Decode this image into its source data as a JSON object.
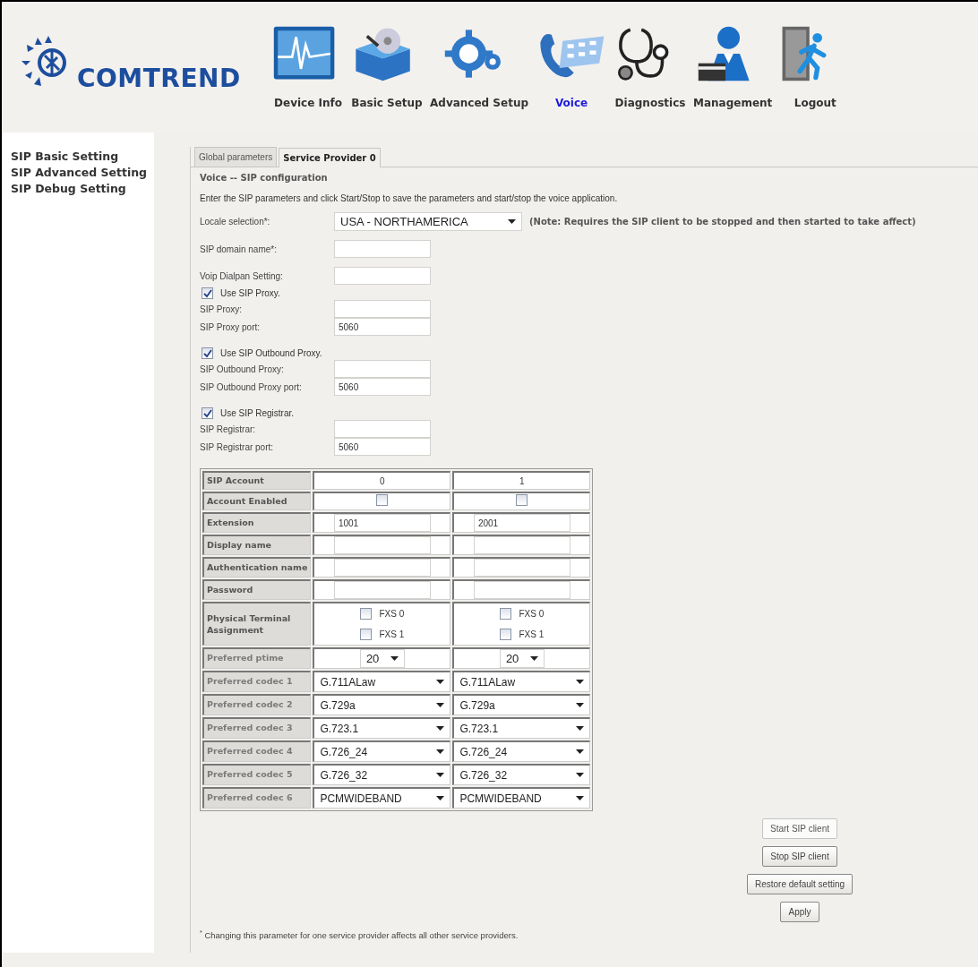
{
  "header": {
    "logo_text": "COMTREND",
    "nav": [
      {
        "label": "Device Info",
        "selected": false
      },
      {
        "label": "Basic Setup",
        "selected": false
      },
      {
        "label": "Advanced Setup",
        "selected": false
      },
      {
        "label": "Voice",
        "selected": true
      },
      {
        "label": "Diagnostics",
        "selected": false
      },
      {
        "label": "Management",
        "selected": false
      },
      {
        "label": "Logout",
        "selected": false
      }
    ]
  },
  "sidebar": {
    "items": [
      {
        "label": "SIP Basic Setting"
      },
      {
        "label": "SIP Advanced Setting"
      },
      {
        "label": "SIP Debug Setting"
      }
    ]
  },
  "tabs": [
    {
      "label": "Global parameters",
      "selected": false
    },
    {
      "label": "Service Provider 0",
      "selected": true
    }
  ],
  "section_title": "Voice -- SIP configuration",
  "intro": "Enter the SIP parameters and click Start/Stop to save the parameters and start/stop the voice application.",
  "locale": {
    "label": "Locale selection*:",
    "value": "USA - NORTHAMERICA",
    "note": "(Note: Requires the SIP client to be stopped and then started to take affect)"
  },
  "field_groups": [
    [
      {
        "kind": "input",
        "label": "SIP domain name*:"
      }
    ],
    [
      {
        "kind": "input",
        "label": "Voip Dialpan Setting:"
      },
      {
        "kind": "check",
        "label": "Use SIP Proxy.",
        "checked": true
      },
      {
        "kind": "input",
        "label": "SIP Proxy:"
      },
      {
        "kind": "input",
        "label": "SIP Proxy port:",
        "value": "5060"
      }
    ],
    [
      {
        "kind": "check",
        "label": "Use SIP Outbound Proxy.",
        "checked": true
      },
      {
        "kind": "input",
        "label": "SIP Outbound Proxy:"
      },
      {
        "kind": "input",
        "label": "SIP Outbound Proxy port:",
        "value": "5060"
      }
    ],
    [
      {
        "kind": "check",
        "label": "Use SIP Registrar.",
        "checked": true
      },
      {
        "kind": "input",
        "label": "SIP Registrar:"
      },
      {
        "kind": "input",
        "label": "SIP Registrar port:",
        "value": "5060"
      }
    ]
  ],
  "accounts": [
    {
      "kind": "header",
      "label": "SIP Account",
      "cells": [
        {
          "value": "0"
        },
        {
          "value": "1"
        }
      ]
    },
    {
      "kind": "checkbox",
      "label": "Account Enabled",
      "cells": [
        {
          "checked": false
        },
        {
          "checked": false
        }
      ]
    },
    {
      "kind": "input",
      "label": "Extension",
      "cells": [
        {
          "value": "1001"
        },
        {
          "value": "2001"
        }
      ]
    },
    {
      "kind": "input",
      "label": "Display name",
      "cells": [
        {},
        {}
      ]
    },
    {
      "kind": "input",
      "label": "Authentication name",
      "cells": [
        {},
        {}
      ]
    },
    {
      "kind": "input",
      "label": "Password",
      "cells": [
        {},
        {}
      ]
    },
    {
      "kind": "terminal",
      "label": "Physical Terminal Assignment",
      "cells": [
        {
          "options": [
            {
              "label": "FXS 0",
              "checked": false
            },
            {
              "label": "FXS 1",
              "checked": false
            }
          ]
        },
        {
          "options": [
            {
              "label": "FXS 0",
              "checked": false
            },
            {
              "label": "FXS 1",
              "checked": false
            }
          ]
        }
      ]
    },
    {
      "kind": "ptime",
      "label": "Preferred ptime",
      "cells": [
        {
          "value": "20"
        },
        {
          "value": "20"
        }
      ]
    },
    {
      "kind": "select",
      "label": "Preferred codec 1",
      "cells": [
        {
          "value": "G.711ALaw"
        },
        {
          "value": "G.711ALaw"
        }
      ]
    },
    {
      "kind": "select",
      "label": "Preferred codec 2",
      "cells": [
        {
          "value": "G.729a"
        },
        {
          "value": "G.729a"
        }
      ]
    },
    {
      "kind": "select",
      "label": "Preferred codec 3",
      "cells": [
        {
          "value": "G.723.1"
        },
        {
          "value": "G.723.1"
        }
      ]
    },
    {
      "kind": "select",
      "label": "Preferred codec 4",
      "cells": [
        {
          "value": "G.726_24"
        },
        {
          "value": "G.726_24"
        }
      ]
    },
    {
      "kind": "select",
      "label": "Preferred codec 5",
      "cells": [
        {
          "value": "G.726_32"
        },
        {
          "value": "G.726_32"
        }
      ]
    },
    {
      "kind": "select",
      "label": "Preferred codec 6",
      "cells": [
        {
          "value": "PCMWIDEBAND"
        },
        {
          "value": "PCMWIDEBAND"
        }
      ]
    }
  ],
  "buttons": [
    {
      "label": "Start SIP client",
      "disabled": true
    },
    {
      "label": "Stop SIP client",
      "disabled": false
    },
    {
      "label": "Restore default setting",
      "disabled": false
    },
    {
      "label": "Apply",
      "disabled": false
    }
  ],
  "footnote": "$^{*}$ Changing this parameter for one service provider affects all other service providers."
}
